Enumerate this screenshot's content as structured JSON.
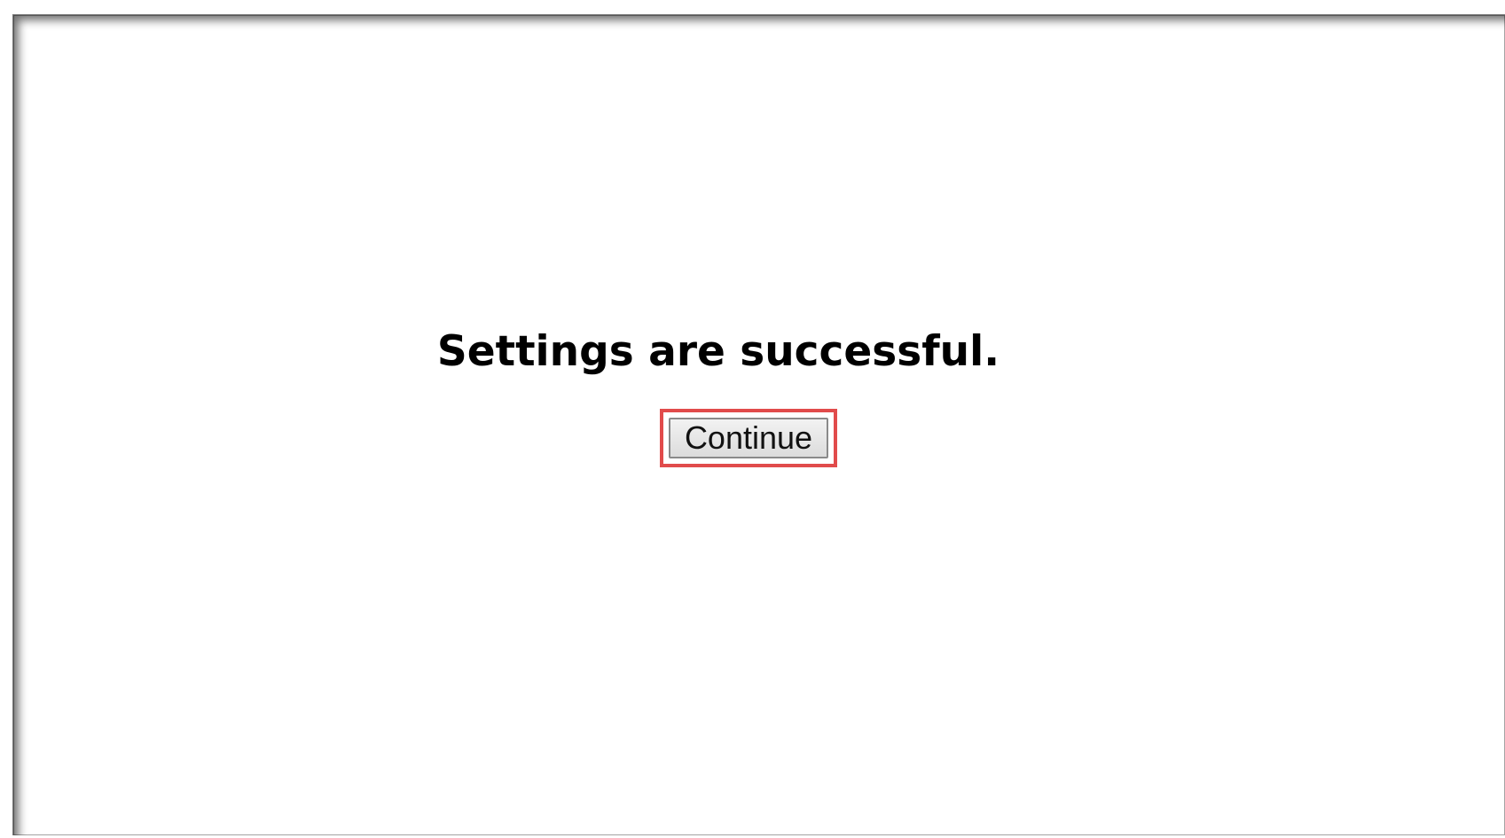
{
  "dialog": {
    "message": "Settings are successful.",
    "continue_label": "Continue"
  },
  "colors": {
    "highlight": "#e14b4b",
    "background": "#ffffff",
    "text": "#000000"
  }
}
